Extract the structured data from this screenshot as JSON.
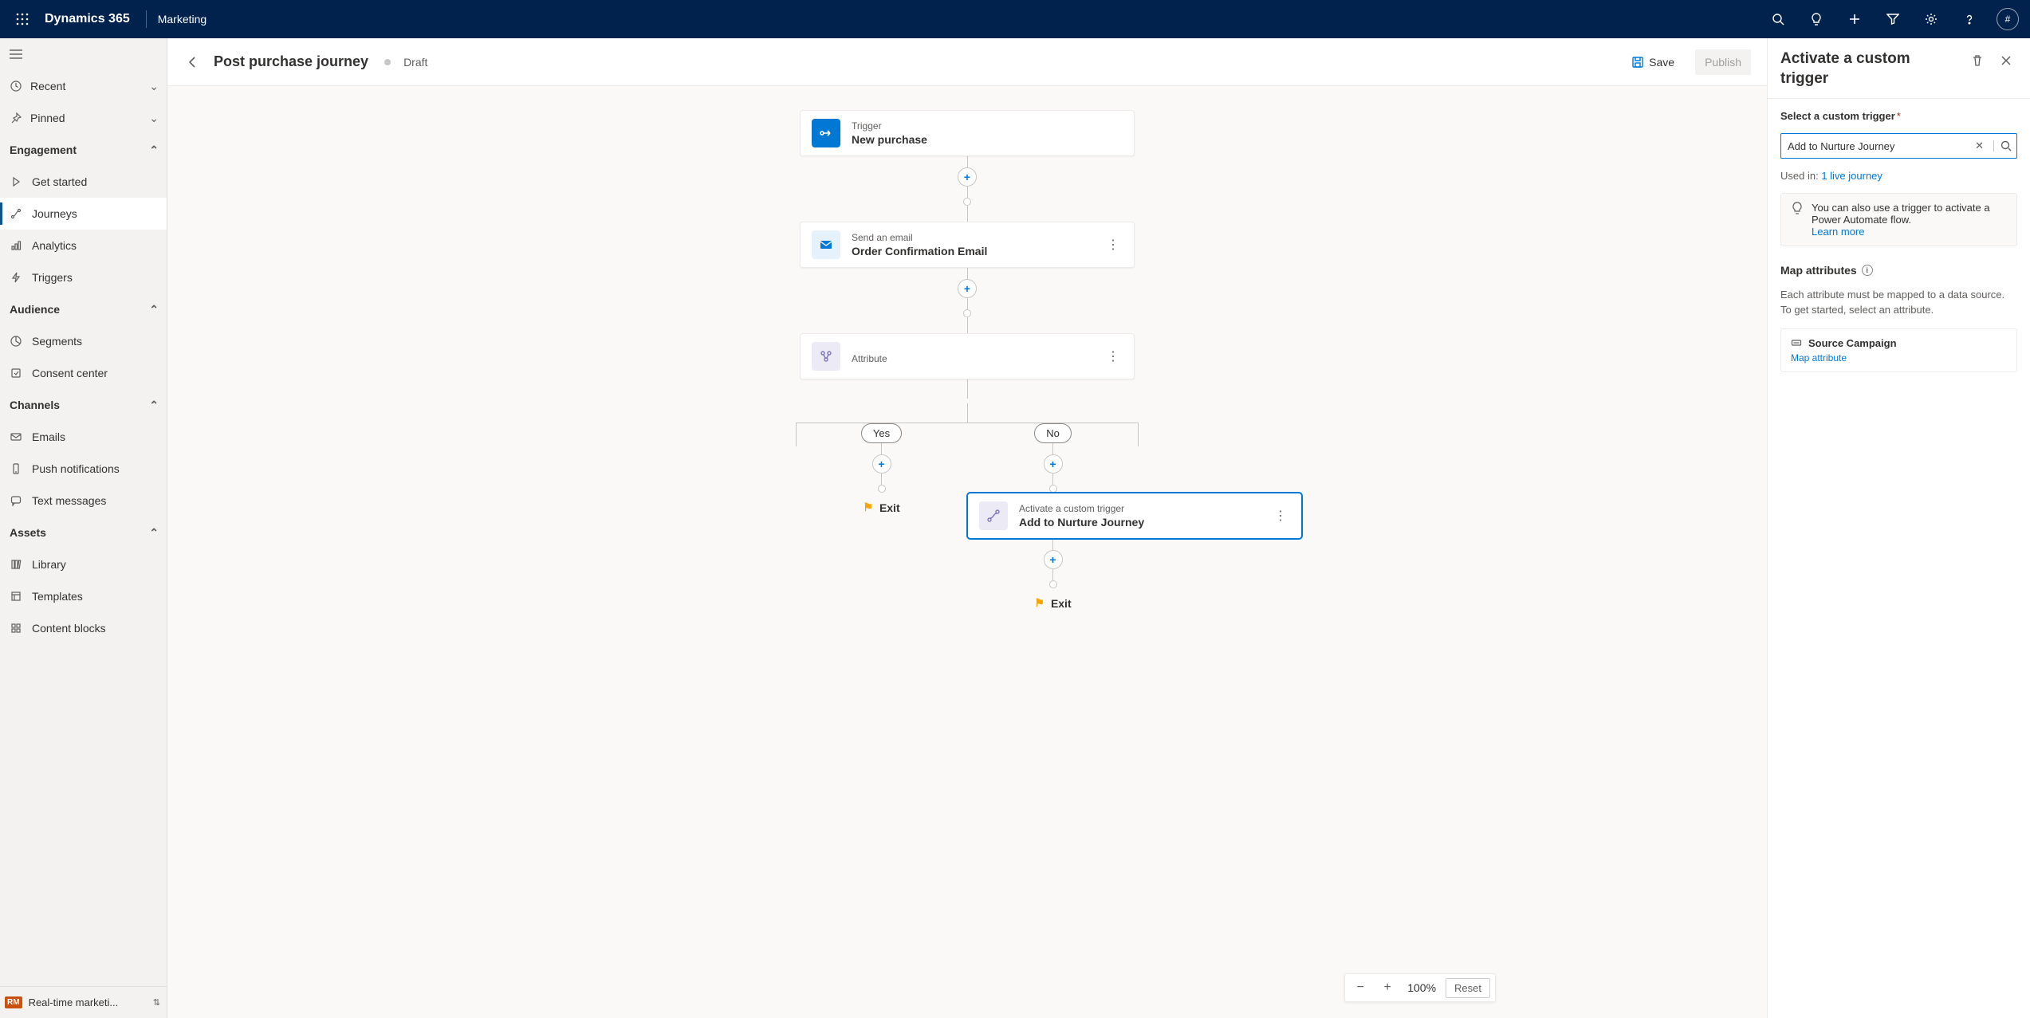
{
  "topbar": {
    "brand": "Dynamics 365",
    "area": "Marketing",
    "avatar_initial": "#"
  },
  "leftnav": {
    "recent": "Recent",
    "pinned": "Pinned",
    "groups": {
      "engagement": {
        "label": "Engagement",
        "items": {
          "get_started": "Get started",
          "journeys": "Journeys",
          "analytics": "Analytics",
          "triggers": "Triggers"
        }
      },
      "audience": {
        "label": "Audience",
        "items": {
          "segments": "Segments",
          "consent": "Consent center"
        }
      },
      "channels": {
        "label": "Channels",
        "items": {
          "emails": "Emails",
          "push": "Push notifications",
          "sms": "Text messages"
        }
      },
      "assets": {
        "label": "Assets",
        "items": {
          "library": "Library",
          "templates": "Templates",
          "blocks": "Content blocks"
        }
      }
    },
    "area_switch_badge": "RM",
    "area_switch_label": "Real-time marketi..."
  },
  "pagehead": {
    "title": "Post purchase journey",
    "status": "Draft",
    "save": "Save",
    "publish": "Publish"
  },
  "zoom": {
    "value": "100%",
    "reset": "Reset"
  },
  "flow": {
    "trigger": {
      "sub": "Trigger",
      "main": "New purchase"
    },
    "email": {
      "sub": "Send an email",
      "main": "Order Confirmation Email"
    },
    "attr": {
      "sub": "Attribute",
      "main": ""
    },
    "branches": {
      "yes": "Yes",
      "no": "No"
    },
    "custom": {
      "sub": "Activate a custom trigger",
      "main": "Add to Nurture Journey"
    },
    "exit": "Exit"
  },
  "panel": {
    "title": "Activate a custom trigger",
    "select_label": "Select a custom trigger",
    "select_value": "Add to Nurture Journey",
    "used_in_prefix": "Used in: ",
    "used_in_link": "1 live journey",
    "info_text": "You can also use a trigger to activate a Power Automate flow.",
    "info_link": "Learn more",
    "map_heading": "Map attributes",
    "map_desc": "Each attribute must be mapped to a data source. To get started, select an attribute.",
    "attr_name": "Source Campaign",
    "attr_link": "Map attribute"
  }
}
